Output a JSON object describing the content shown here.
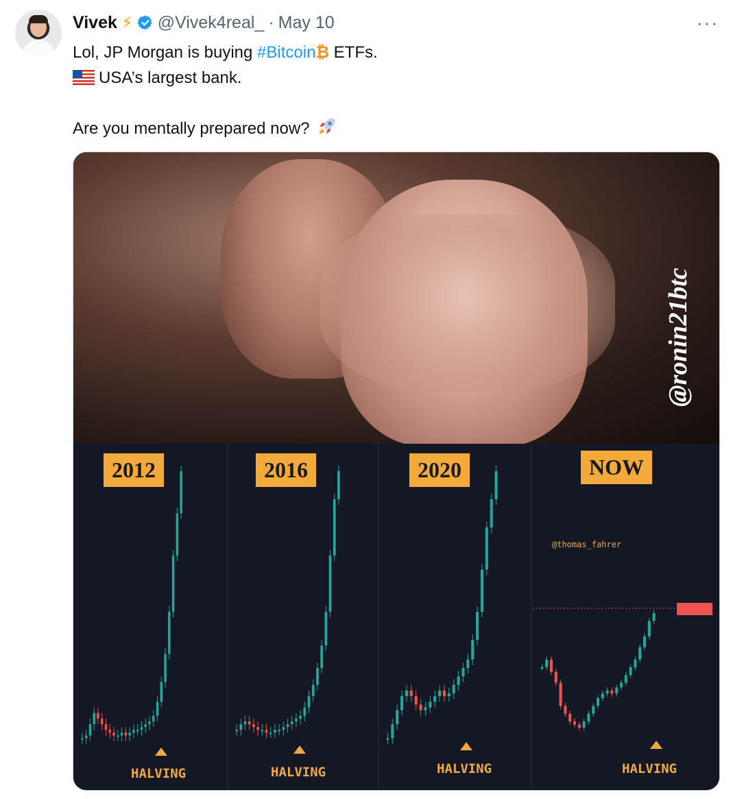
{
  "tweet": {
    "name": "Vivek",
    "bolt": "⚡",
    "handle": "@Vivek4real_",
    "dot": "·",
    "date": "May 10",
    "more": "···",
    "line1_prefix": "Lol, JP Morgan is buying ",
    "hashtag": "#Bitcoin",
    "btc_symbol": "₿",
    "line1_suffix": " ETFs.",
    "line2": "USA’s largest bank.",
    "line3": "Are you mentally prepared now? "
  },
  "meme": {
    "watermark": "@ronin21btc",
    "panels": [
      {
        "label": "2012",
        "halving": "HALVING"
      },
      {
        "label": "2016",
        "halving": "HALVING"
      },
      {
        "label": "2020",
        "halving": "HALVING"
      },
      {
        "label": "NOW",
        "halving": "HALVING"
      }
    ],
    "author_tag": "@thomas_fahrer",
    "colors": {
      "label_bg": "#f4a93b",
      "up": "#26a69a",
      "down": "#ef5350",
      "bg": "#141824"
    }
  }
}
